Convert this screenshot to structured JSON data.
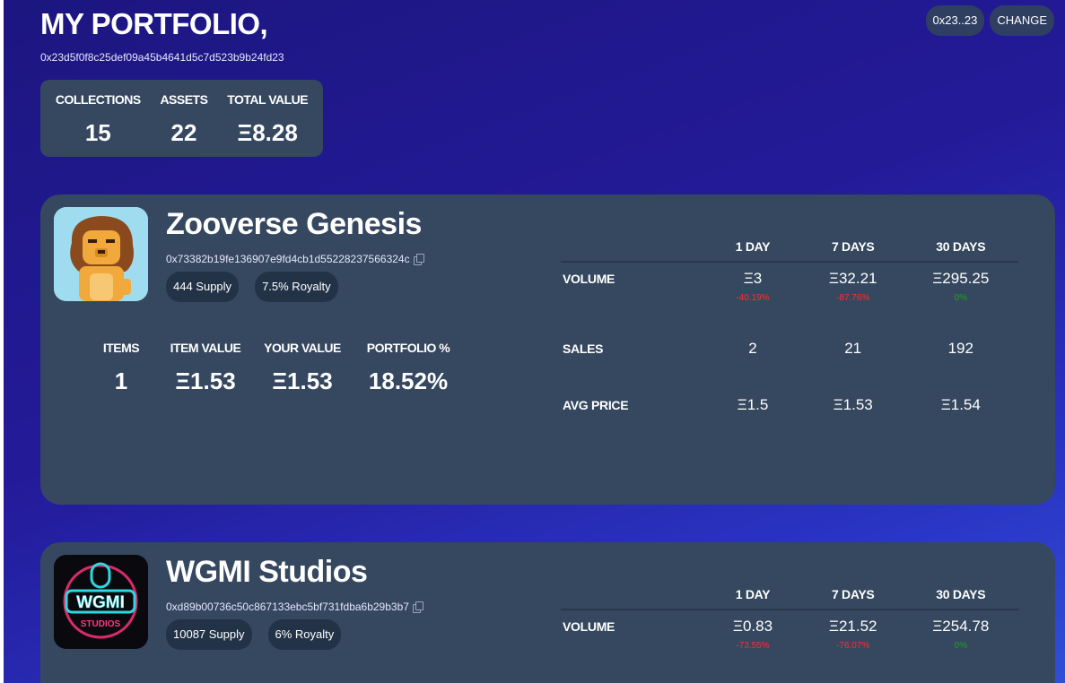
{
  "header": {
    "title": "MY PORTFOLIO,",
    "wallet": "0x23d5f0f8c25def09a45b4641d5c7d523b9b24fd23",
    "short_wallet": "0x23..23",
    "change_label": "CHANGE"
  },
  "summary": {
    "collections_label": "COLLECTIONS",
    "collections_value": "15",
    "assets_label": "ASSETS",
    "assets_value": "22",
    "total_label": "TOTAL VALUE",
    "total_value": "Ξ8.28"
  },
  "market_headers": {
    "d1": "1 DAY",
    "d7": "7 DAYS",
    "d30": "30 DAYS"
  },
  "collections": [
    {
      "name": "Zooverse Genesis",
      "address": "0x73382b19fe136907e9fd4cb1d55228237566324c",
      "supply": "444 Supply",
      "royalty": "7.5% Royalty",
      "items_label": "ITEMS",
      "items": "1",
      "item_value_label": "ITEM VALUE",
      "item_value": "Ξ1.53",
      "your_value_label": "YOUR VALUE",
      "your_value": "Ξ1.53",
      "portfolio_label": "PORTFOLIO %",
      "portfolio": "18.52%",
      "volume_label": "VOLUME",
      "volume": {
        "d1": "Ξ3",
        "d7": "Ξ32.21",
        "d30": "Ξ295.25"
      },
      "volume_change": {
        "d1": "-40.19%",
        "d7": "-87.76%",
        "d30": "0%"
      },
      "sales_label": "SALES",
      "sales": {
        "d1": "2",
        "d7": "21",
        "d30": "192"
      },
      "avg_label": "AVG PRICE",
      "avg": {
        "d1": "Ξ1.5",
        "d7": "Ξ1.53",
        "d30": "Ξ1.54"
      }
    },
    {
      "name": "WGMI Studios",
      "address": "0xd89b00736c50c867133ebc5bf731fdba6b29b3b7",
      "supply": "10087 Supply",
      "royalty": "6% Royalty",
      "logo_text": "WGMI",
      "logo_subtext": "STUDIOS",
      "volume_label": "VOLUME",
      "volume": {
        "d1": "Ξ0.83",
        "d7": "Ξ21.52",
        "d30": "Ξ254.78"
      },
      "volume_change": {
        "d1": "-73.55%",
        "d7": "-76.07%",
        "d30": "0%"
      }
    }
  ],
  "colors": {
    "background": "#231a98",
    "card": "#35485f",
    "negative": "#ff2d2d",
    "neutral": "#1fa01f"
  }
}
